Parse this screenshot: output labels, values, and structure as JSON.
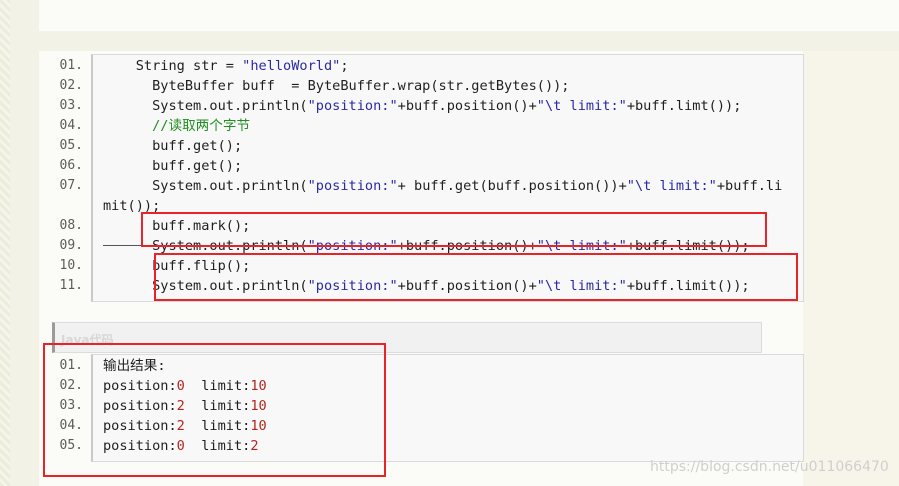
{
  "code_block_1": {
    "lines": [
      {
        "num": "01.",
        "parts": [
          {
            "t": "    String str = ",
            "c": ""
          },
          {
            "t": "\"helloWorld\"",
            "c": "str"
          },
          {
            "t": ";",
            "c": ""
          }
        ]
      },
      {
        "num": "02.",
        "parts": [
          {
            "t": "      ByteBuffer buff  = ByteBuffer.wrap(str.getBytes());",
            "c": ""
          }
        ]
      },
      {
        "num": "03.",
        "parts": [
          {
            "t": "      System.out.println(",
            "c": ""
          },
          {
            "t": "\"position:\"",
            "c": "str"
          },
          {
            "t": "+buff.position()+",
            "c": ""
          },
          {
            "t": "\"\\t limit:\"",
            "c": "str"
          },
          {
            "t": "+buff.limt());",
            "c": ""
          }
        ]
      },
      {
        "num": "04.",
        "parts": [
          {
            "t": "      //读取两个字节",
            "c": "cmt"
          }
        ]
      },
      {
        "num": "05.",
        "parts": [
          {
            "t": "      buff.get();",
            "c": ""
          }
        ]
      },
      {
        "num": "06.",
        "parts": [
          {
            "t": "      buff.get();",
            "c": ""
          }
        ]
      },
      {
        "num": "07.",
        "parts": [
          {
            "t": "      System.out.println(",
            "c": ""
          },
          {
            "t": "\"position:\"",
            "c": "str"
          },
          {
            "t": "+ buff.get(buff.position())+",
            "c": ""
          },
          {
            "t": "\"\\t limit:\"",
            "c": "str"
          },
          {
            "t": "+buff.li",
            "c": ""
          }
        ]
      },
      {
        "num": "",
        "parts": [
          {
            "t": "mit());",
            "c": ""
          }
        ]
      },
      {
        "num": "08.",
        "parts": [
          {
            "t": "      buff.mark();",
            "c": ""
          }
        ]
      },
      {
        "num": "09.",
        "parts": [
          {
            "t": "      System.out.println(",
            "c": ""
          },
          {
            "t": "\"position:\"",
            "c": "str"
          },
          {
            "t": "+buff.position()+",
            "c": ""
          },
          {
            "t": "\"\\t limit:\"",
            "c": "str"
          },
          {
            "t": "+buff.limit());",
            "c": ""
          }
        ]
      },
      {
        "num": "10.",
        "parts": [
          {
            "t": "      buff.flip();",
            "c": ""
          }
        ]
      },
      {
        "num": "11.",
        "parts": [
          {
            "t": "      System.out.println(",
            "c": ""
          },
          {
            "t": "\"position:\"",
            "c": "str"
          },
          {
            "t": "+buff.position()+",
            "c": ""
          },
          {
            "t": "\"\\t limit:\"",
            "c": "str"
          },
          {
            "t": "+buff.limit());",
            "c": ""
          }
        ]
      }
    ]
  },
  "code_block_2": {
    "header": "Java代码",
    "lines": [
      {
        "num": "01.",
        "parts": [
          {
            "t": "输出结果:",
            "c": ""
          }
        ]
      },
      {
        "num": "02.",
        "parts": [
          {
            "t": "position:",
            "c": ""
          },
          {
            "t": "0",
            "c": "num"
          },
          {
            "t": "  limit:",
            "c": ""
          },
          {
            "t": "10",
            "c": "num"
          }
        ]
      },
      {
        "num": "03.",
        "parts": [
          {
            "t": "position:",
            "c": ""
          },
          {
            "t": "2",
            "c": "num"
          },
          {
            "t": "  limit:",
            "c": ""
          },
          {
            "t": "10",
            "c": "num"
          }
        ]
      },
      {
        "num": "04.",
        "parts": [
          {
            "t": "position:",
            "c": ""
          },
          {
            "t": "2",
            "c": "num"
          },
          {
            "t": "  limit:",
            "c": ""
          },
          {
            "t": "10",
            "c": "num"
          }
        ]
      },
      {
        "num": "05.",
        "parts": [
          {
            "t": "position:",
            "c": ""
          },
          {
            "t": "0",
            "c": "num"
          },
          {
            "t": "  limit:",
            "c": ""
          },
          {
            "t": "2",
            "c": "num"
          }
        ]
      }
    ]
  },
  "watermark": "https://blog.csdn.net/u011066470",
  "colors": {
    "highlight": "#e8232a",
    "string": "#2a2aa6",
    "comment": "#1f8f1f",
    "number": "#b3261e"
  }
}
